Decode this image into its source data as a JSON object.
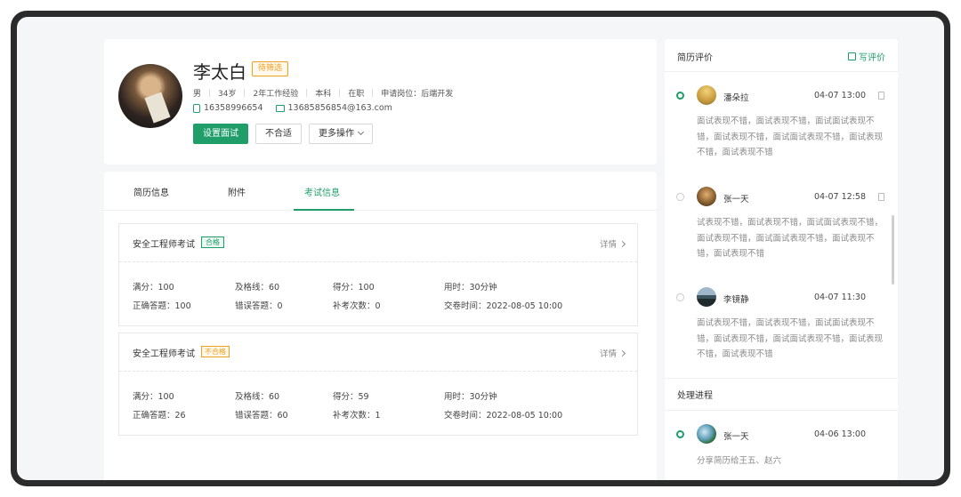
{
  "profile": {
    "name": "李太白",
    "status_tag": "待筛选",
    "meta": [
      "男",
      "34岁",
      "2年工作经验",
      "本科",
      "在职",
      "申请岗位：后端开发"
    ],
    "phone": "16358996654",
    "email": "13685856854@163.com",
    "buttons": {
      "schedule": "设置面试",
      "reject": "不合适",
      "more": "更多操作"
    }
  },
  "tabs": [
    {
      "label": "简历信息",
      "active": false
    },
    {
      "label": "附件",
      "active": false
    },
    {
      "label": "考试信息",
      "active": true
    }
  ],
  "exams": [
    {
      "title": "安全工程师考试",
      "result": "合格",
      "detail": "详情",
      "full_score": "满分：100",
      "pass_line": "及格线：60",
      "score": "得分：100",
      "duration": "用时：30分钟",
      "correct": "正确答题：100",
      "wrong": "错误答题：0",
      "retakes": "补考次数：0",
      "submitted": "交卷时间：2022-08-05  10:00"
    },
    {
      "title": "安全工程师考试",
      "result": "不合格",
      "detail": "详情",
      "full_score": "满分：100",
      "pass_line": "及格线：60",
      "score": "得分：59",
      "duration": "用时：30分钟",
      "correct": "正确答题：26",
      "wrong": "错误答题：60",
      "retakes": "补考次数：1",
      "submitted": "交卷时间：2022-08-05  10:00"
    }
  ],
  "reviews": {
    "title": "简历评价",
    "write_label": "写评价",
    "items": [
      {
        "name": "潘朵拉",
        "time": "04-07  13:00",
        "active": true,
        "text": "面试表现不错，面试表现不错，面试面试表现不错，面试表现不错，面试面试表现不错，面试表现不错，面试表现不错"
      },
      {
        "name": "张一天",
        "time": "04-07  12:58",
        "active": false,
        "text": "试表现不错，面试表现不错，面试面试表现不错，面试表现不错，面试面试表现不错，面试表现不错，面试表现不错"
      },
      {
        "name": "李镜静",
        "time": "04-07  11:30",
        "active": false,
        "text": "面试表现不错，面试表现不错，面试面试表现不错，面试表现不错，面试面试表现不错，面试表现不错，面试表现不错"
      }
    ]
  },
  "process": {
    "title": "处理进程",
    "items": [
      {
        "name": "张一天",
        "time": "04-06  13:00",
        "text": "分享简历给王五、赵六",
        "active": true
      }
    ]
  },
  "colors": {
    "accent": "#1f9e6a",
    "warning": "#f0a020"
  }
}
